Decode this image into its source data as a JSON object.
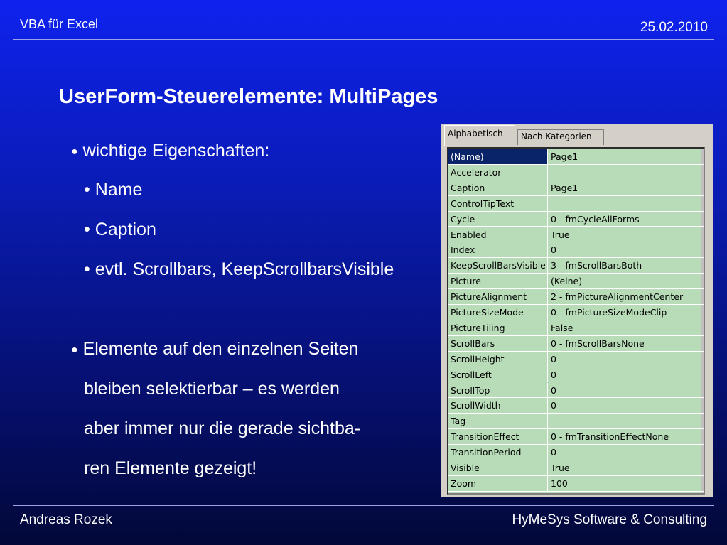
{
  "header": {
    "left": "VBA für Excel",
    "right": "25.02.2010"
  },
  "title": "UserForm-Steuerelemente: MultiPages",
  "bullets": {
    "b1": "wichtige Eigenschaften:",
    "s1": "• Name",
    "s2": "• Caption",
    "s3": "• evtl. Scrollbars, KeepScrollbarsVisible",
    "b2": "Elemente auf den einzelnen Seiten",
    "c1": "bleiben selektierbar – es werden",
    "c2": "aber immer nur die gerade sichtba-",
    "c3": "ren Elemente gezeigt!",
    "dot": "●"
  },
  "footer": {
    "left": "Andreas Rozek",
    "right": "HyMeSys Software & Consulting"
  },
  "properties": {
    "tabs": [
      "Alphabetisch",
      "Nach Kategorien"
    ],
    "rows": [
      {
        "k": "(Name)",
        "v": "Page1"
      },
      {
        "k": "Accelerator",
        "v": ""
      },
      {
        "k": "Caption",
        "v": "Page1"
      },
      {
        "k": "ControlTipText",
        "v": ""
      },
      {
        "k": "Cycle",
        "v": "0 - fmCycleAllForms"
      },
      {
        "k": "Enabled",
        "v": "True"
      },
      {
        "k": "Index",
        "v": "0"
      },
      {
        "k": "KeepScrollBarsVisible",
        "v": "3 - fmScrollBarsBoth"
      },
      {
        "k": "Picture",
        "v": "(Keine)"
      },
      {
        "k": "PictureAlignment",
        "v": "2 - fmPictureAlignmentCenter"
      },
      {
        "k": "PictureSizeMode",
        "v": "0 - fmPictureSizeModeClip"
      },
      {
        "k": "PictureTiling",
        "v": "False"
      },
      {
        "k": "ScrollBars",
        "v": "0 - fmScrollBarsNone"
      },
      {
        "k": "ScrollHeight",
        "v": "0"
      },
      {
        "k": "ScrollLeft",
        "v": "0"
      },
      {
        "k": "ScrollTop",
        "v": "0"
      },
      {
        "k": "ScrollWidth",
        "v": "0"
      },
      {
        "k": "Tag",
        "v": ""
      },
      {
        "k": "TransitionEffect",
        "v": "0 - fmTransitionEffectNone"
      },
      {
        "k": "TransitionPeriod",
        "v": "0"
      },
      {
        "k": "Visible",
        "v": "True"
      },
      {
        "k": "Zoom",
        "v": "100"
      }
    ]
  }
}
